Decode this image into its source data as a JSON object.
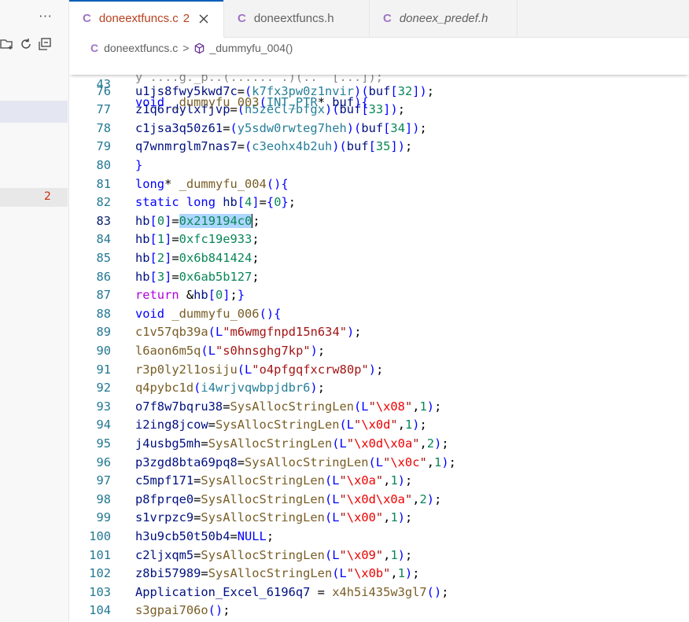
{
  "sidebar": {
    "more_label": "···",
    "problem_count": "2"
  },
  "tabs": [
    {
      "icon": "C",
      "name": "doneextfuncs.c",
      "count": "2"
    },
    {
      "icon": "C",
      "name": "doneextfuncs.h"
    },
    {
      "icon": "C",
      "name": "doneex_predef.h"
    }
  ],
  "breadcrumb": {
    "icon": "C",
    "file": "doneextfuncs.c",
    "separator": ">",
    "symbol": "_dummyfu_004()"
  },
  "sticky": {
    "line_number": "43",
    "text": "void _dummyfu_003(INT_PTR* buf){"
  },
  "editor_lines": [
    {
      "n": "76",
      "text": "u1js8fwy5kwd7c=(k7fx3pw0z1nvir)(buf[32]);"
    },
    {
      "n": "77",
      "text": "z1q6rdylxfjvp=(h5zecl7bfgx)(buf[33]);"
    },
    {
      "n": "78",
      "text": "c1jsa3q50z61=(y5sdw0rwteg7heh)(buf[34]);"
    },
    {
      "n": "79",
      "text": "q7wnmrglm7nas7=(c3eohx4b2uh)(buf[35]);"
    },
    {
      "n": "80",
      "text": "}"
    },
    {
      "n": "81",
      "text": "long* _dummyfu_004(){"
    },
    {
      "n": "82",
      "text": "static long hb[4]={0};"
    },
    {
      "n": "83",
      "text": "hb[0]=0x219194c0;",
      "current": true
    },
    {
      "n": "84",
      "text": "hb[1]=0xfc19e933;"
    },
    {
      "n": "85",
      "text": "hb[2]=0x6b841424;"
    },
    {
      "n": "86",
      "text": "hb[3]=0x6ab5b127;"
    },
    {
      "n": "87",
      "text": "return &hb[0];}"
    },
    {
      "n": "88",
      "text": "void _dummyfu_006(){"
    },
    {
      "n": "89",
      "text": "c1v57qb39a(L\"m6wmgfnpd15n634\");"
    },
    {
      "n": "90",
      "text": "l6aon6m5q(L\"s0hnsghg7kp\");"
    },
    {
      "n": "91",
      "text": "r3p0ly2l1osiju(L\"o4pfgqfxcrw80p\");"
    },
    {
      "n": "92",
      "text": "q4pybc1d(i4wrjvqwbpjdbr6);"
    },
    {
      "n": "93",
      "text": "o7f8w7bqru38=SysAllocStringLen(L\"\\x08\",1);"
    },
    {
      "n": "94",
      "text": "i2ing8jcow=SysAllocStringLen(L\"\\x0d\",1);"
    },
    {
      "n": "95",
      "text": "j4usbg5mh=SysAllocStringLen(L\"\\x0d\\x0a\",2);"
    },
    {
      "n": "96",
      "text": "p3zgd8bta69pq8=SysAllocStringLen(L\"\\x0c\",1);"
    },
    {
      "n": "97",
      "text": "c5mpf171=SysAllocStringLen(L\"\\x0a\",1);"
    },
    {
      "n": "98",
      "text": "p8fprqe0=SysAllocStringLen(L\"\\x0d\\x0a\",2);"
    },
    {
      "n": "99",
      "text": "s1vrpzc9=SysAllocStringLen(L\"\\x00\",1);"
    },
    {
      "n": "100",
      "text": "h3u9cb50t50b4=NULL;"
    },
    {
      "n": "101",
      "text": "c2ljxqm5=SysAllocStringLen(L\"\\x09\",1);"
    },
    {
      "n": "102",
      "text": "z8bi57989=SysAllocStringLen(L\"\\x0b\",1);"
    },
    {
      "n": "103",
      "text": "Application_Excel_6196q7 = x4h5i435w3gl7();"
    },
    {
      "n": "104",
      "text": "s3gpai706o();"
    }
  ],
  "selection_text": "0x219194c0",
  "colors": {
    "keyword": "#0000ff",
    "control": "#af00db",
    "function": "#795e26",
    "type": "#267f99",
    "number": "#098658",
    "string": "#a31515",
    "escape": "#ee0000",
    "variable": "#001080",
    "line_number": "#237893",
    "error": "#b8401f"
  }
}
